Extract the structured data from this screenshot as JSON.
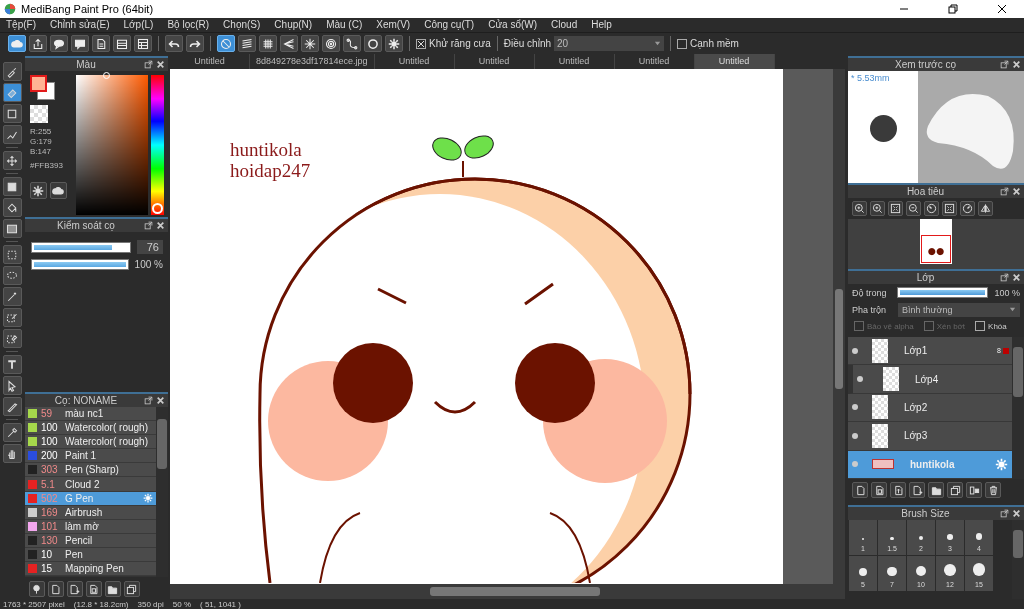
{
  "window": {
    "title": "MediBang Paint Pro (64bit)"
  },
  "menu": [
    "Tệp(F)",
    "Chỉnh sửa(E)",
    "Lớp(L)",
    "Bộ lọc(R)",
    "Chọn(S)",
    "Chụp(N)",
    "Màu (C)",
    "Xem(V)",
    "Công cụ(T)",
    "Cửa sổ(W)",
    "Cloud",
    "Help"
  ],
  "toolbar": {
    "buttons": [
      {
        "kind": "cloud",
        "selected": true
      },
      {
        "kind": "upload",
        "selected": false
      },
      {
        "kind": "speech",
        "selected": false
      },
      {
        "kind": "comment",
        "selected": false
      },
      {
        "kind": "page",
        "selected": false
      },
      {
        "kind": "list",
        "selected": false
      },
      {
        "kind": "table",
        "selected": false
      },
      {
        "kind": "undo",
        "selected": false
      },
      {
        "kind": "redo",
        "selected": false
      },
      {
        "kind": "no-snap",
        "selected": true
      },
      {
        "kind": "parallel",
        "selected": false
      },
      {
        "kind": "grid",
        "selected": false
      },
      {
        "kind": "perspective",
        "selected": false
      },
      {
        "kind": "radial",
        "selected": false
      },
      {
        "kind": "concentric",
        "selected": false
      },
      {
        "kind": "curve",
        "selected": false
      },
      {
        "kind": "circle",
        "selected": false
      },
      {
        "kind": "gear",
        "selected": false
      }
    ],
    "antialias": {
      "label": "Khử răng cưa",
      "checked": true
    },
    "adjust": {
      "label": "Điều chỉnh",
      "value": "20"
    },
    "soft_edge": {
      "label": "Cạnh mềm",
      "checked": false
    }
  },
  "tools": [
    {
      "kind": "brush",
      "selected": false
    },
    {
      "kind": "eraser",
      "selected": true
    },
    {
      "kind": "square",
      "selected": false
    },
    {
      "kind": "polyline",
      "selected": false
    },
    {
      "kind": "move",
      "selected": false
    },
    {
      "kind": "filled-square",
      "selected": false
    },
    {
      "kind": "bucket",
      "selected": false
    },
    {
      "kind": "gradient",
      "selected": false
    },
    {
      "kind": "dashed-rect",
      "selected": false
    },
    {
      "kind": "lasso",
      "selected": false
    },
    {
      "kind": "wand",
      "selected": false
    },
    {
      "kind": "dashed-pen",
      "selected": false
    },
    {
      "kind": "dashed-eraser",
      "selected": false
    },
    {
      "kind": "text",
      "selected": false
    },
    {
      "kind": "pointer",
      "selected": false
    },
    {
      "kind": "knife",
      "selected": false
    },
    {
      "kind": "eyedropper",
      "selected": false
    },
    {
      "kind": "hand",
      "selected": false
    }
  ],
  "color_panel": {
    "title": "Màu",
    "r": "R:255",
    "g": "G:179",
    "b": "B:147",
    "hex": "#FFB393"
  },
  "brush_control": {
    "title": "Kiểm soát cọ",
    "size": {
      "level": 0.83,
      "reading": "76"
    },
    "opacity": {
      "level": 1,
      "reading": "100 %"
    }
  },
  "brush_list": {
    "title": "Cọ: NONAME",
    "items": [
      {
        "size": "59",
        "name": "màu nc1",
        "color": "#a6d84b",
        "custom": true,
        "selected": false
      },
      {
        "size": "100",
        "name": "Watercolor( rough)",
        "color": "#a6d84b",
        "custom": false,
        "selected": false
      },
      {
        "size": "100",
        "name": "Watercolor( rough)",
        "color": "#a6d84b",
        "custom": false,
        "selected": false
      },
      {
        "size": "200",
        "name": "Paint 1",
        "color": "#2a4de0",
        "custom": false,
        "selected": false
      },
      {
        "size": "303",
        "name": "Pen (Sharp)",
        "color": "#222222",
        "custom": true,
        "selected": false
      },
      {
        "size": "5.1",
        "name": "Cloud 2",
        "color": "#e52222",
        "custom": true,
        "selected": false
      },
      {
        "size": "502",
        "name": "G Pen",
        "color": "#e52222",
        "custom": true,
        "selected": true
      },
      {
        "size": "169",
        "name": "Airbrush",
        "color": "#cccccc",
        "custom": true,
        "selected": false
      },
      {
        "size": "101",
        "name": "làm mờ",
        "color": "#f4a8f0",
        "custom": true,
        "selected": false
      },
      {
        "size": "130",
        "name": "Pencil",
        "color": "#222222",
        "custom": true,
        "selected": false
      },
      {
        "size": "10",
        "name": "Pen",
        "color": "#222222",
        "custom": false,
        "selected": false
      },
      {
        "size": "15",
        "name": "Mapping Pen",
        "color": "#e52222",
        "custom": false,
        "selected": false
      }
    ]
  },
  "doc_tabs": [
    {
      "label": "Untitled",
      "selected": false
    },
    {
      "label": "8d849278e3df17814ece.jpg",
      "selected": false
    },
    {
      "label": "Untitled",
      "selected": false
    },
    {
      "label": "Untitled",
      "selected": false
    },
    {
      "label": "Untitled",
      "selected": false
    },
    {
      "label": "Untitled",
      "selected": false
    },
    {
      "label": "Untitled",
      "selected": true
    }
  ],
  "canvas": {
    "text": [
      "huntikola",
      "hoidap247"
    ]
  },
  "brush_preview": {
    "title": "Xem trước cọ",
    "size": "* 5.53mm"
  },
  "navigator": {
    "title": "Hoa tiêu"
  },
  "layers": {
    "title": "Lớp",
    "opacity": {
      "label": "Độ trong",
      "level": 1,
      "reading": "100 %"
    },
    "blend": {
      "label": "Pha trộn",
      "value": "Bình thường"
    },
    "options": [
      {
        "label": "Bảo vệ alpha",
        "checked": false,
        "disabled": true
      },
      {
        "label": "Xén bớt",
        "checked": false,
        "disabled": true
      },
      {
        "label": "Khóa",
        "checked": false,
        "disabled": false
      }
    ],
    "items": [
      {
        "name": "Lớp1",
        "badge": "8",
        "clipped": false,
        "selected": false
      },
      {
        "name": "Lớp4",
        "clipped": true,
        "selected": false
      },
      {
        "name": "Lớp2",
        "clipped": false,
        "selected": false
      },
      {
        "name": "Lớp3",
        "clipped": false,
        "selected": false
      },
      {
        "name": "huntikola",
        "clipped": false,
        "selected": true
      }
    ]
  },
  "brush_size": {
    "title": "Brush Size",
    "sizes": [
      "1",
      "1.5",
      "2",
      "3",
      "4",
      "5",
      "7",
      "10",
      "12",
      "15"
    ]
  },
  "status_bar": {
    "dimensions": "1763 * 2507 pixel",
    "physical": "(12.8 * 18.2cm)",
    "dpi": "350 dpi",
    "zoom": "50 %",
    "position": "( 51, 1041 )"
  }
}
